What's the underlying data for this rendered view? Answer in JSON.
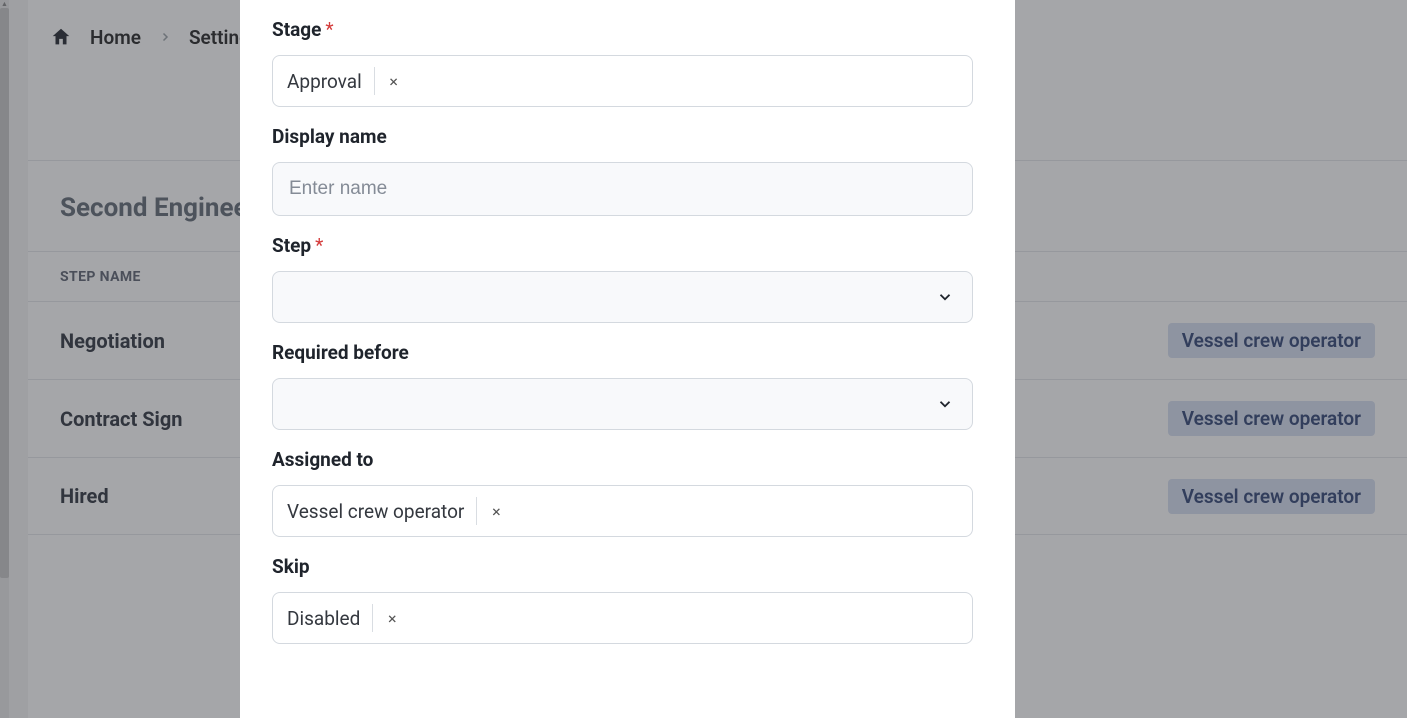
{
  "breadcrumb": {
    "home": "Home",
    "settings": "Settings"
  },
  "panel": {
    "title": "Second Engineer",
    "column_header": "STEP NAME",
    "rows": [
      {
        "name": "Negotiation",
        "assignee": "Vessel crew operator"
      },
      {
        "name": "Contract Sign",
        "assignee": "Vessel crew operator"
      },
      {
        "name": "Hired",
        "assignee": "Vessel crew operator"
      }
    ]
  },
  "modal": {
    "stage": {
      "label": "Stage",
      "value": "Approval"
    },
    "display_name": {
      "label": "Display name",
      "placeholder": "Enter name"
    },
    "step": {
      "label": "Step"
    },
    "required_before": {
      "label": "Required before"
    },
    "assigned_to": {
      "label": "Assigned to",
      "value": "Vessel crew operator"
    },
    "skip": {
      "label": "Skip",
      "value": "Disabled"
    }
  }
}
